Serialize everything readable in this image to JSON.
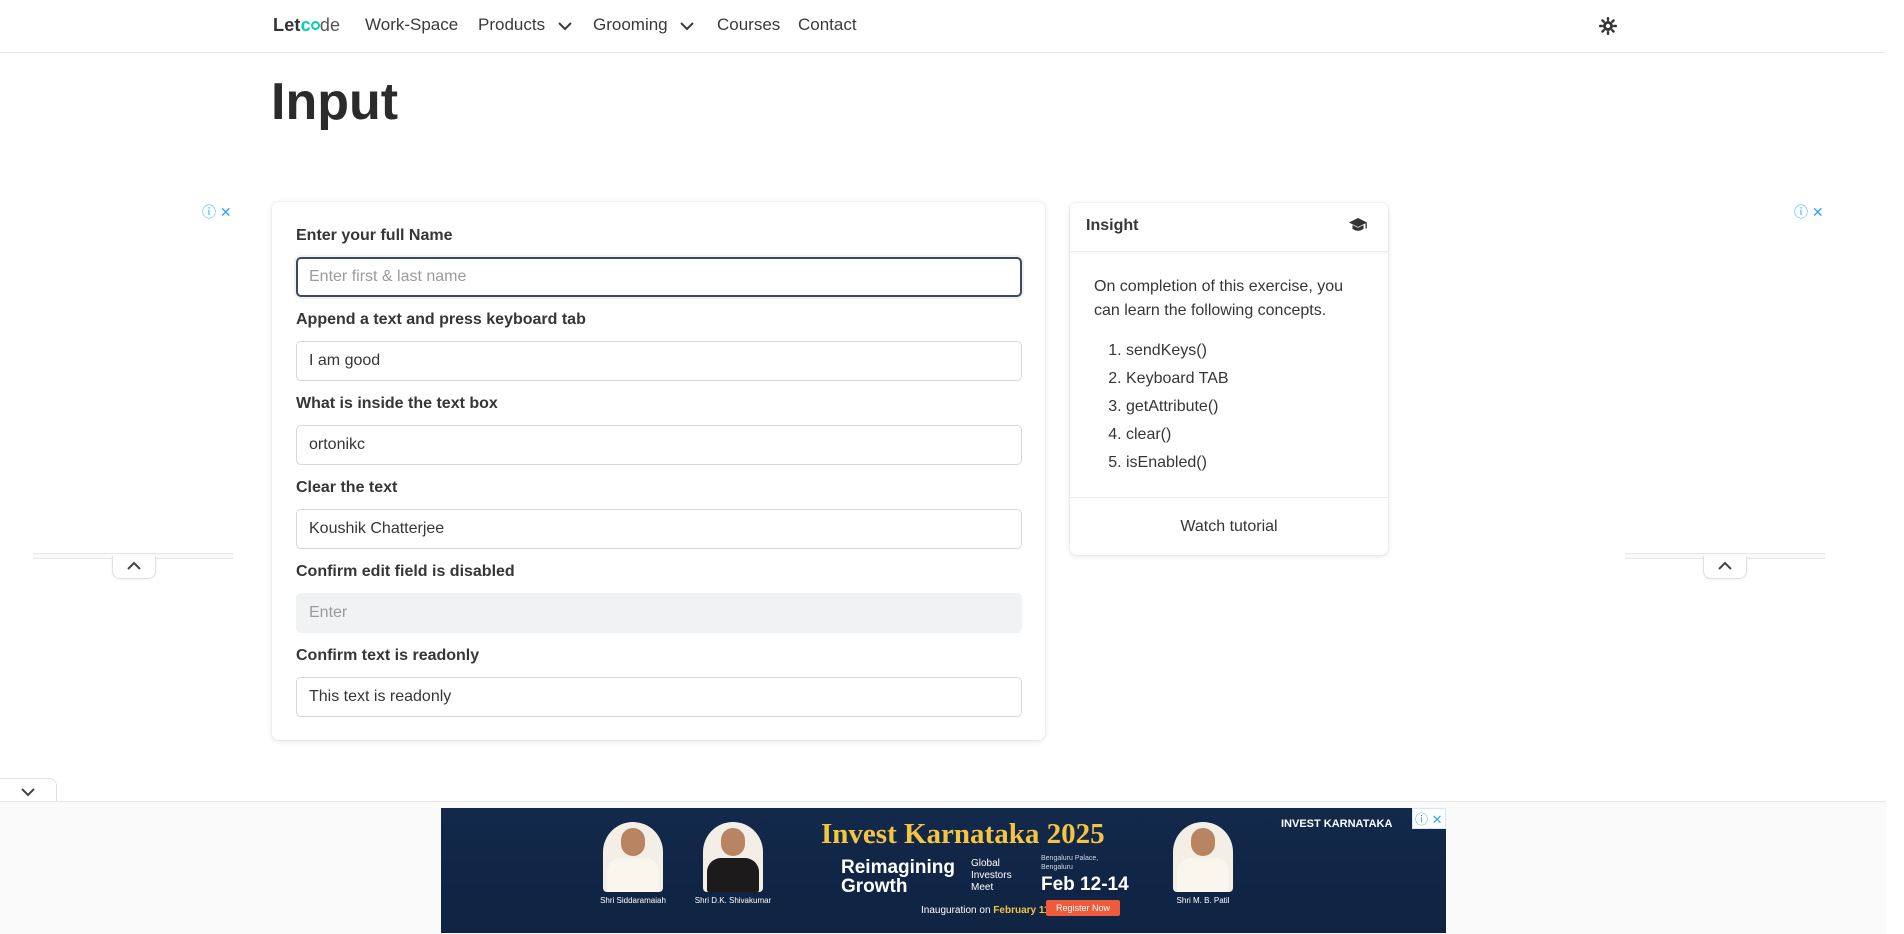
{
  "nav": {
    "brand_prefix": "Let",
    "brand_o": "c◖de",
    "items": [
      "Work-Space",
      "Products",
      "Grooming",
      "Courses",
      "Contact"
    ],
    "icons": {
      "theme": "gear-icon",
      "chevron": "chevron-down-icon"
    }
  },
  "page": {
    "title": "Input"
  },
  "form": {
    "fields": [
      {
        "label": "Enter your full Name",
        "value": "",
        "placeholder": "Enter first & last name",
        "state": "focused"
      },
      {
        "label": "Append a text and press keyboard tab",
        "value": "I am good",
        "placeholder": ""
      },
      {
        "label": "What is inside the text box",
        "value": "ortonikc",
        "placeholder": ""
      },
      {
        "label": "Clear the text",
        "value": "Koushik Chatterjee",
        "placeholder": ""
      },
      {
        "label": "Confirm edit field is disabled",
        "value": "",
        "placeholder": "Enter",
        "state": "disabled"
      },
      {
        "label": "Confirm text is readonly",
        "value": "This text is readonly",
        "placeholder": "",
        "state": "readonly"
      }
    ]
  },
  "insight": {
    "title": "Insight",
    "intro": "On completion of this exercise, you can learn the following concepts.",
    "concepts": [
      "sendKeys()",
      "Keyboard TAB",
      "getAttribute()",
      "clear()",
      "isEnabled()"
    ],
    "footer_link": "Watch tutorial"
  },
  "ads": {
    "info": "ⓘ",
    "close": "✕",
    "banner": {
      "title": "Invest Karnataka 2025",
      "tagline": "Reimagining Growth",
      "event": "Global Investors Meet",
      "location": "Bengaluru Palace, Bengaluru",
      "dates": "Feb 12-14",
      "inauguration_prefix": "Inauguration on",
      "inauguration_date": "February 11",
      "register": "Register Now",
      "brand": "INVEST KARNATAKA",
      "people": [
        "Shri Siddaramaiah",
        "Shri D.K. Shivakumar",
        "Shri M. B. Patil"
      ]
    }
  }
}
